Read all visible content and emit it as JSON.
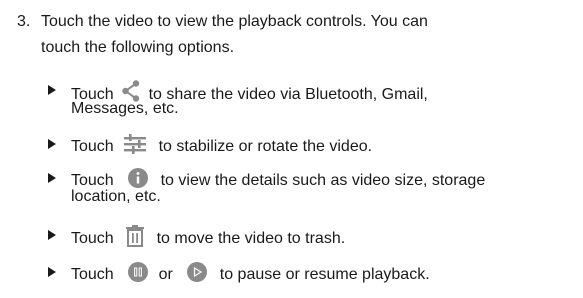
{
  "step": {
    "number": "3.",
    "line1": "Touch the video to view the playback controls. You can",
    "line2": "touch the following options."
  },
  "bullets": [
    {
      "before": "Touch",
      "icon": "share-icon",
      "after": "to share the video via Bluetooth, Gmail,",
      "continuation": "Messages, etc."
    },
    {
      "before": "Touch",
      "icon": "adjust-sliders-icon",
      "after": "to stabilize or rotate the video."
    },
    {
      "before": "Touch",
      "icon": "info-icon",
      "after": "to view the details such as video size, storage",
      "continuation": "location, etc."
    },
    {
      "before": "Touch",
      "icon": "trash-icon",
      "after": "to move the video to trash."
    },
    {
      "before": "Touch",
      "icon_pause": "pause-icon",
      "middle": "or",
      "icon_play": "play-icon",
      "after": "to pause or resume playback."
    }
  ],
  "colors": {
    "text": "#1a1a1a",
    "icon": "#8a8a8a"
  }
}
